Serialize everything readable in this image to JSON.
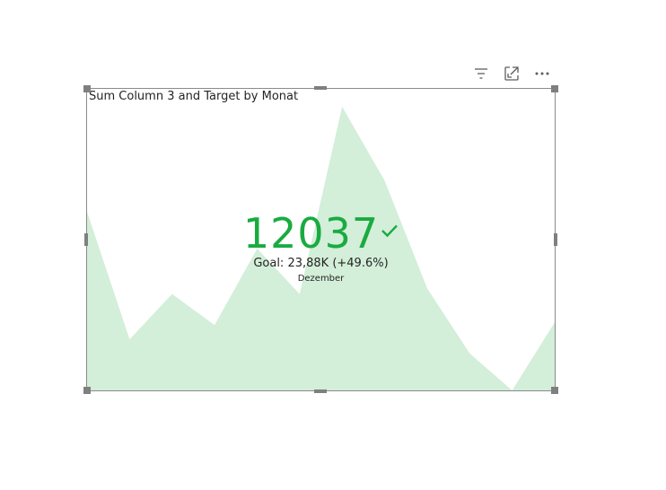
{
  "header": {
    "icons": [
      "filter-icon",
      "focus-mode-icon",
      "more-options-icon"
    ]
  },
  "visual": {
    "title": "Sum Column 3 and Target by Monat",
    "kpi": {
      "value": "12037",
      "goal": "Goal: 23,88K (+49.6%)",
      "period": "Dezember",
      "status_icon": "check-icon"
    }
  },
  "colors": {
    "kpi_value": "#1aab40",
    "area_fill": "#d3eed9",
    "border": "#8a8a8a",
    "handle": "#7f7f7f"
  },
  "chart_data": {
    "type": "area",
    "x": [
      "1",
      "2",
      "3",
      "4",
      "5",
      "6",
      "7",
      "8",
      "9",
      "10",
      "11",
      "12"
    ],
    "values": [
      0.63,
      0.18,
      0.34,
      0.23,
      0.5,
      0.34,
      1.0,
      0.74,
      0.36,
      0.13,
      0.0,
      0.24
    ],
    "ylim": [
      0,
      1
    ],
    "grid": false,
    "legend": "none"
  }
}
